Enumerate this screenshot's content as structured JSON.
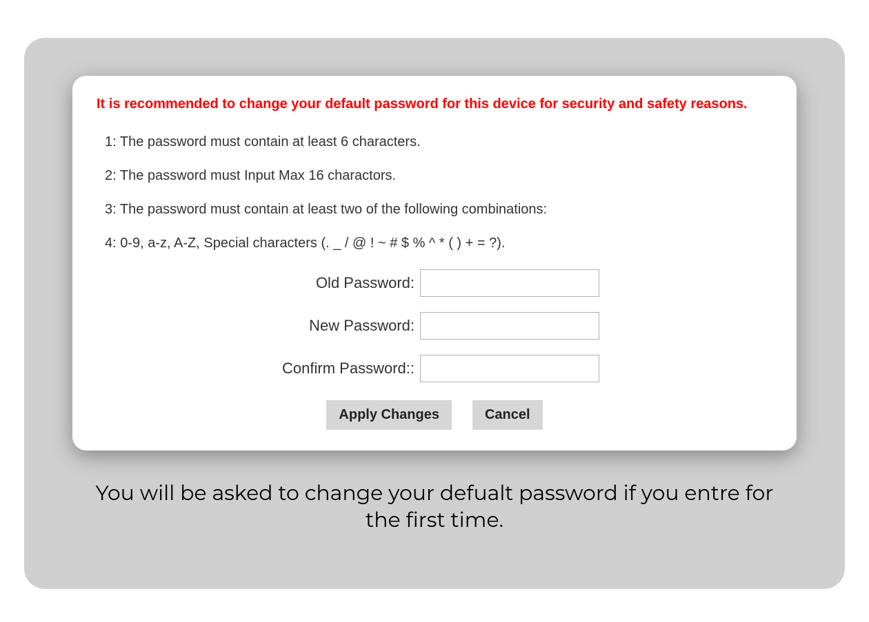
{
  "warning": "It is recommended to change your default password for this device for security and safety reasons.",
  "rules": {
    "r1": "1: The password must contain at least 6 characters.",
    "r2": "2: The password must Input Max 16 charactors.",
    "r3": "3: The password must contain at least two of the following combinations:",
    "r4": "4: 0-9, a-z, A-Z, Special characters (. _ / @ ! ~ # $ % ^ * ( ) + = ?)."
  },
  "form": {
    "old_label": "Old Password:",
    "new_label": "New Password:",
    "confirm_label": "Confirm Password::",
    "old_value": "",
    "new_value": "",
    "confirm_value": ""
  },
  "buttons": {
    "apply": "Apply Changes",
    "cancel": "Cancel"
  },
  "caption": "You will be asked to change your defualt password if you entre for the first time."
}
